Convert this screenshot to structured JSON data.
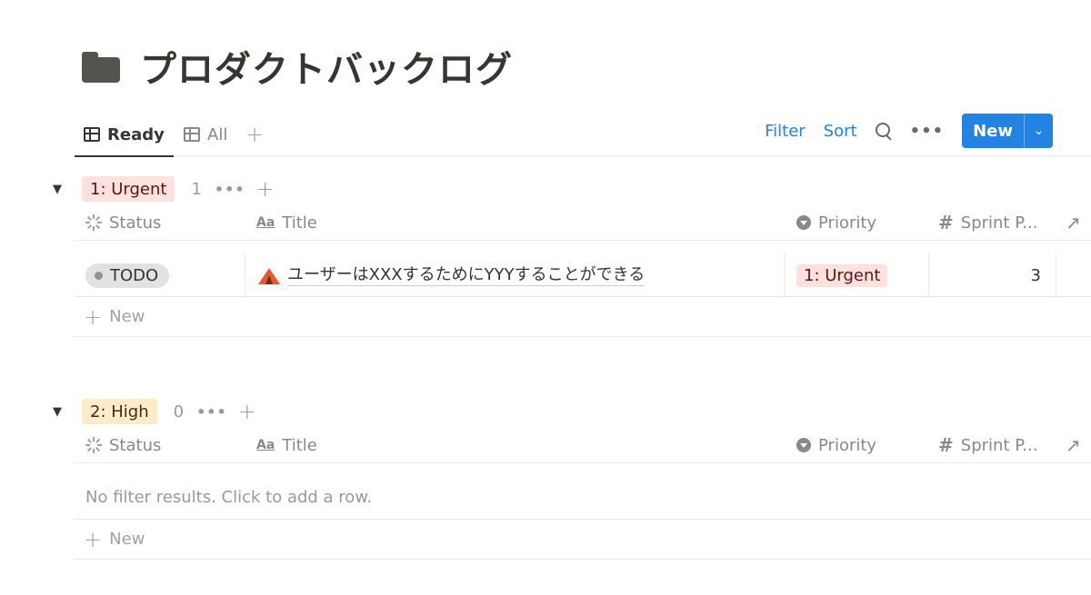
{
  "page": {
    "title": "プロダクトバックログ",
    "icon": "folder-icon"
  },
  "views": {
    "tabs": [
      {
        "label": "Ready",
        "icon": "table-icon",
        "active": true
      },
      {
        "label": "All",
        "icon": "table-icon",
        "active": false
      }
    ],
    "add_label": "+"
  },
  "toolbar": {
    "filter_label": "Filter",
    "sort_label": "Sort",
    "more_label": "•••",
    "new_label": "New",
    "accent": "#2383e2"
  },
  "columns": {
    "status": "Status",
    "title": "Title",
    "priority": "Priority",
    "sprint": "Sprint P..."
  },
  "groups": [
    {
      "label": "1: Urgent",
      "count": "1",
      "color": "#ffe2dd",
      "rows": [
        {
          "status": "TODO",
          "title": "ユーザーはXXXするためにYYYすることができる",
          "priority": "1: Urgent",
          "sprint": "3",
          "icon": "tent-icon"
        }
      ],
      "add_label": "New"
    },
    {
      "label": "2: High",
      "count": "0",
      "color": "#fdecc8",
      "empty_text": "No filter results. Click to add a row.",
      "add_label": "New"
    }
  ]
}
